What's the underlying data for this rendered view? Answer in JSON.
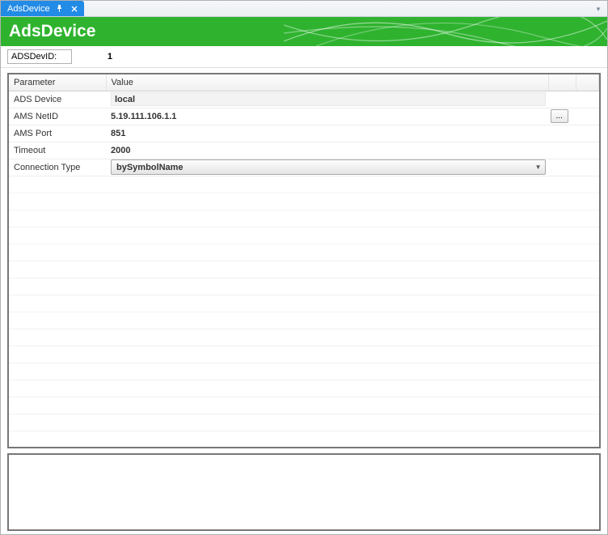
{
  "tab": {
    "title": "AdsDevice"
  },
  "header": {
    "title": "AdsDevice"
  },
  "devid": {
    "label": "ADSDevID:",
    "value": "1"
  },
  "table": {
    "columns": {
      "param": "Parameter",
      "value": "Value"
    },
    "rows": [
      {
        "param": "ADS Device",
        "value": "local",
        "kind": "readonly"
      },
      {
        "param": "AMS NetID",
        "value": "5.19.111.106.1.1",
        "kind": "browse",
        "browse_label": "..."
      },
      {
        "param": "AMS Port",
        "value": "851",
        "kind": "plain"
      },
      {
        "param": "Timeout",
        "value": "2000",
        "kind": "plain"
      },
      {
        "param": "Connection Type",
        "value": "bySymbolName",
        "kind": "combo"
      }
    ]
  }
}
